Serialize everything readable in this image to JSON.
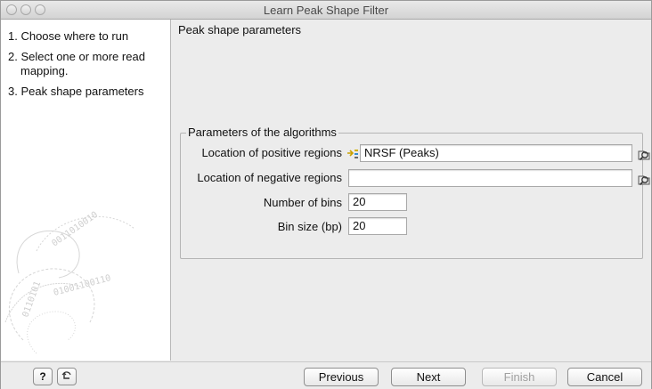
{
  "window": {
    "title": "Learn Peak Shape Filter"
  },
  "sidebar": {
    "steps": [
      {
        "label": "1. Choose where to run"
      },
      {
        "label": "2. Select one or more read"
      },
      {
        "label": "mapping."
      },
      {
        "label": "3. Peak shape parameters"
      }
    ]
  },
  "main": {
    "page_title": "Peak shape parameters",
    "group": {
      "title": "Parameters of the algorithms",
      "positive_label": "Location of positive regions",
      "positive_value": "NRSF (Peaks)",
      "negative_label": "Location of negative regions",
      "negative_value": "",
      "bins_label": "Number of bins",
      "bins_value": "20",
      "binsize_label": "Bin size (bp)",
      "binsize_value": "20"
    }
  },
  "footer": {
    "help_label": "?",
    "previous_label": "Previous",
    "next_label": "Next",
    "finish_label": "Finish",
    "cancel_label": "Cancel"
  },
  "icons": {
    "help": "question-icon",
    "reset": "reset-arrow-icon",
    "track": "peak-track-icon",
    "browse": "browse-folder-icon"
  }
}
